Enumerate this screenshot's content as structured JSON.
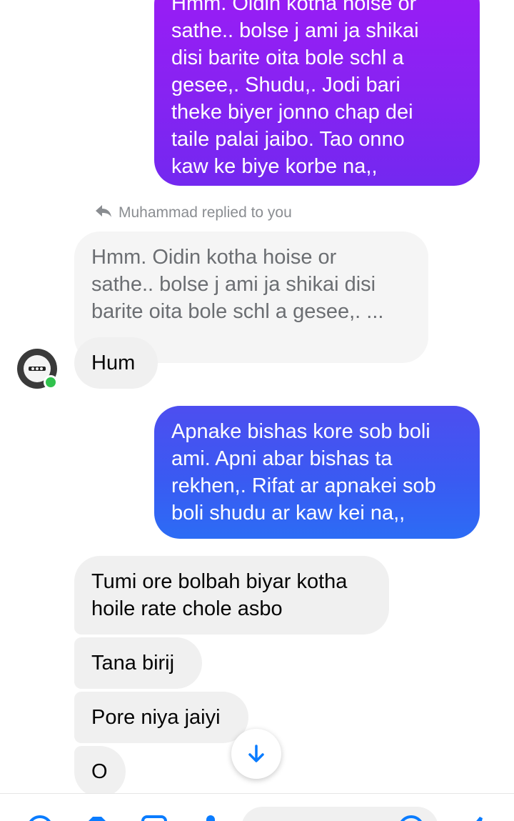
{
  "conversation": {
    "outgoing_1": "Hmm.  Oidin kotha hoise or\nsathe.. bolse j ami ja shikai\ndisi barite oita bole schl a\ngesee,. Shudu,. Jodi bari\ntheke biyer jonno chap dei\ntaile palai jaibo. Tao onno\nkaw ke biye korbe na,,",
    "reply_label": "Muhammad replied to you",
    "quoted_text": "Hmm.  Oidin kotha hoise or\nsathe.. bolse j ami ja shikai disi\nbarite oita bole schl a gesee,. ...",
    "incoming_hum": "Hum",
    "outgoing_2": "Apnake bishas kore sob boli\nami.  Apni abar bishas ta\nrekhen,. Rifat ar apnakei sob\nboli shudu ar kaw kei na,,",
    "incoming_1": "Tumi ore bolbah biyar kotha\nhoile rate chole asbo",
    "incoming_2": "Tana birij",
    "incoming_3": "Pore niya jaiyi",
    "incoming_4": "O"
  },
  "icons": {
    "reply": "reply-arrow-icon",
    "avatar": "contact-avatar",
    "online": "online-status-dot",
    "scroll": "scroll-to-bottom-arrow-icon"
  },
  "colors": {
    "outgoing_gradient_top": "#9b1cf5",
    "outgoing_gradient_bottom": "#2c6cf5",
    "incoming_bubble": "#f0f0f0",
    "online": "#31c24d",
    "accent": "#0a7cff"
  }
}
